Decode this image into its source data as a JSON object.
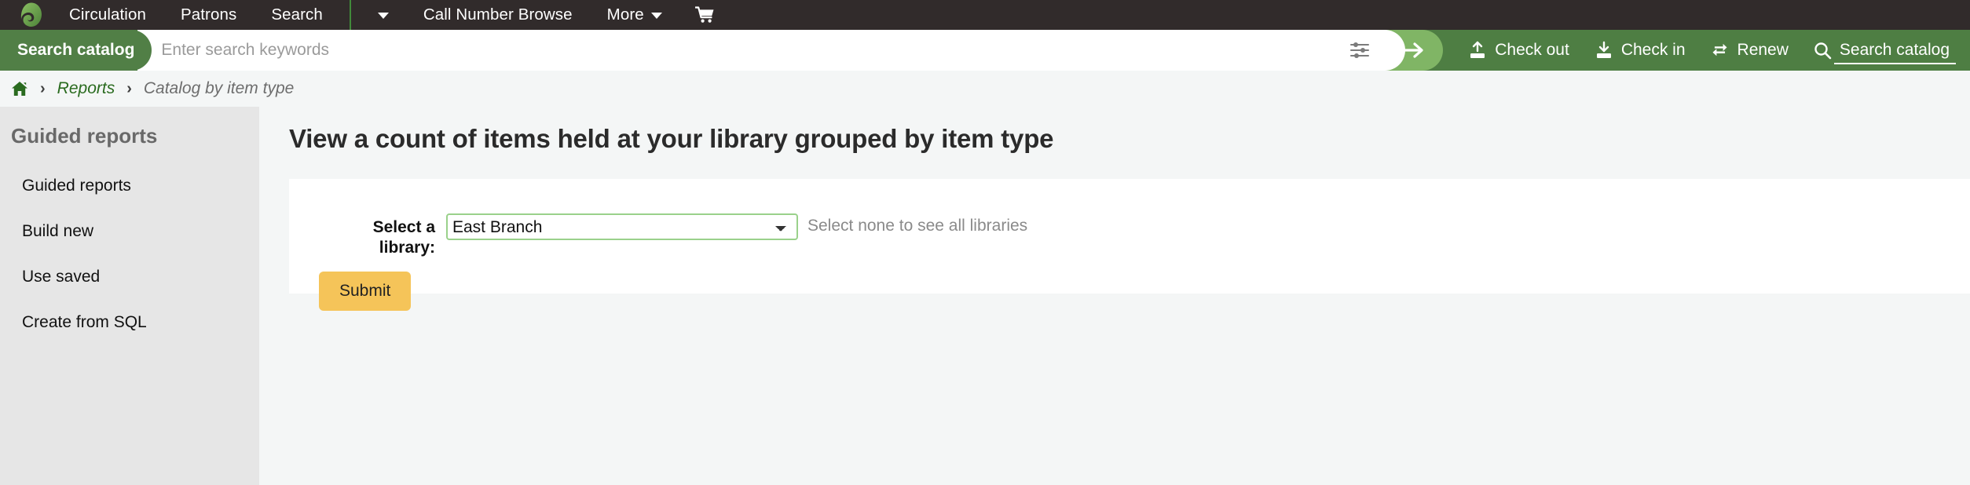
{
  "topnav": {
    "logo_name": "koha-logo",
    "items": [
      {
        "label": "Circulation",
        "name": "nav-circulation"
      },
      {
        "label": "Patrons",
        "name": "nav-patrons"
      },
      {
        "label": "Search",
        "name": "nav-search"
      }
    ],
    "dropdown_caret_name": "nav-dropdown-caret",
    "items_after": [
      {
        "label": "Call Number Browse",
        "name": "nav-call-number-browse"
      }
    ],
    "more": {
      "label": "More",
      "name": "nav-more"
    },
    "cart_icon": "shopping-cart-icon",
    "bg_color": "#312b2b",
    "separator_color": "#418a3a"
  },
  "searchbar": {
    "tab_label": "Search catalog",
    "placeholder": "Enter search keywords",
    "value": "",
    "sliders_icon": "sliders-filter-icon",
    "submit_arrow_icon": "arrow-right-icon",
    "bg_color": "#4e7e43",
    "go_color": "#80b565",
    "actions": [
      {
        "label": "Check out",
        "icon": "check-out-icon",
        "active": false,
        "name": "action-check-out"
      },
      {
        "label": "Check in",
        "icon": "check-in-icon",
        "active": false,
        "name": "action-check-in"
      },
      {
        "label": "Renew",
        "icon": "renew-icon",
        "active": false,
        "name": "action-renew"
      },
      {
        "label": "Search catalog",
        "icon": "search-icon",
        "active": true,
        "name": "action-search-catalog"
      }
    ]
  },
  "breadcrumb": {
    "home_icon": "home-icon",
    "separator": "›",
    "link": "Reports",
    "current": "Catalog by item type",
    "link_color": "#2a6b1f"
  },
  "sidebar": {
    "heading": "Guided reports",
    "items": [
      {
        "label": "Guided reports",
        "name": "sidebar-item-guided-reports"
      },
      {
        "label": "Build new",
        "name": "sidebar-item-build-new"
      },
      {
        "label": "Use saved",
        "name": "sidebar-item-use-saved"
      },
      {
        "label": "Create from SQL",
        "name": "sidebar-item-create-from-sql"
      }
    ],
    "bg_color": "#e6e6e6"
  },
  "main": {
    "title": "View a count of items held at your library grouped by item type",
    "form": {
      "label": "Select a library:",
      "selected_library": "East Branch",
      "library_options": [
        "East Branch"
      ],
      "hint": "Select none to see all libraries",
      "submit_label": "Submit",
      "submit_color": "#f5c459",
      "select_border_color": "#9ad18b"
    }
  }
}
